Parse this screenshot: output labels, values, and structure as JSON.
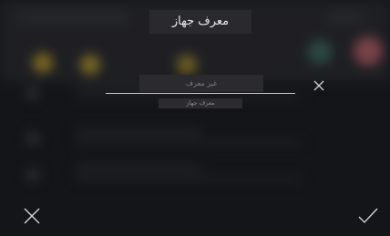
{
  "dialog": {
    "title": "معرف جهاز",
    "input_value": "",
    "input_placeholder": "غير معرف",
    "hint": "معرف جهاز"
  },
  "icons": {
    "clear": "close-icon",
    "cancel": "close-icon",
    "confirm": "check-icon"
  },
  "colors": {
    "background": "#1b1c1f",
    "text": "#e9e9ec",
    "underline": "#c9c9cd"
  }
}
